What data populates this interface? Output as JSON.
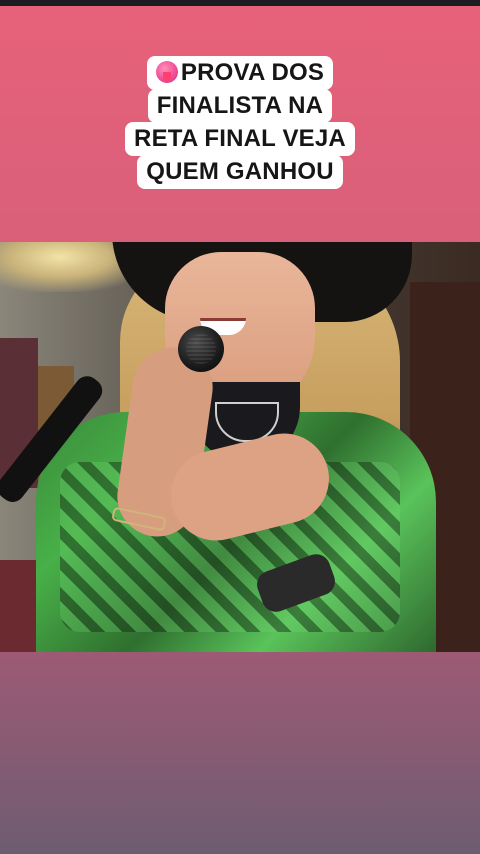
{
  "caption": {
    "emoji": "tongue-emoji",
    "lines": [
      "PROVA DOS",
      "FINALISTA NA",
      "RETA FINAL VEJA",
      "QUEM GANHOU"
    ]
  },
  "colors": {
    "background_top": "#e8617a",
    "background_bottom": "#6e5c72",
    "caption_background": "#ffffff",
    "caption_text": "#161616",
    "shirt_green": "#48b048"
  }
}
